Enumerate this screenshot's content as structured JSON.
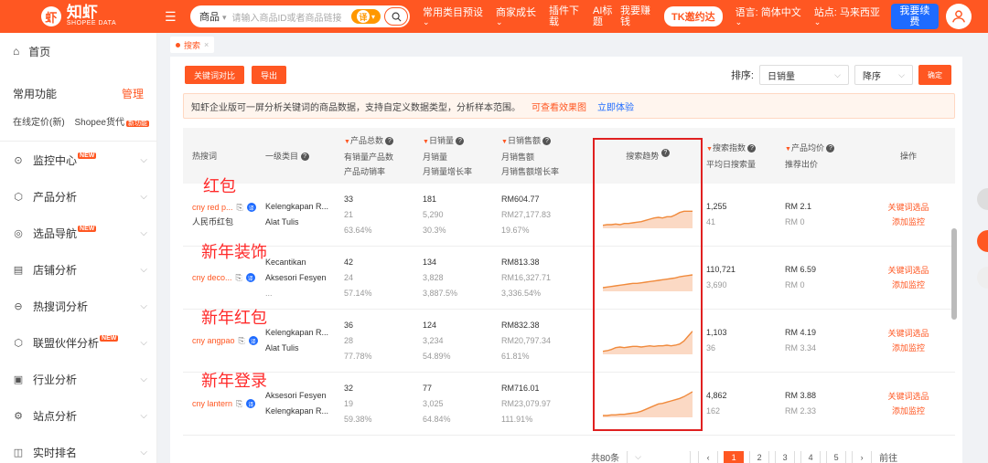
{
  "topbar": {
    "logo_text": "知虾",
    "logo_sub": "SHOPEE DATA",
    "search_select": "商品",
    "search_placeholder": "请输入商品ID或者商品链接",
    "search_badge": "译",
    "nav": [
      {
        "label": "常用类目预设",
        "chev": "⌄"
      },
      {
        "label": "商家成长",
        "chev": "⌄"
      },
      {
        "label": "插件下载",
        "chev": ""
      },
      {
        "label": "AI标题",
        "chev": ""
      },
      {
        "label": "我要赚钱",
        "chev": ""
      }
    ],
    "tk_label": "TK邀约达",
    "language": "语言: 简体中文",
    "site": "站点: 马来西亚",
    "renew_label": "我要续费"
  },
  "sidebar": {
    "home": "首页",
    "common": "常用功能",
    "manage": "管理",
    "quick_left": "在线定价(新)",
    "quick_right": "Shopee货代",
    "quick_tag": "新功能",
    "new_tag": "NEW",
    "items": [
      {
        "label": "监控中心",
        "icon": "⊙",
        "new": true
      },
      {
        "label": "产品分析",
        "icon": "⬡",
        "new": false
      },
      {
        "label": "选品导航",
        "icon": "◎",
        "new": true
      },
      {
        "label": "店铺分析",
        "icon": "▤",
        "new": false
      },
      {
        "label": "热搜词分析",
        "icon": "⊖",
        "new": false
      },
      {
        "label": "联盟伙伴分析",
        "icon": "⬡",
        "new": true
      },
      {
        "label": "行业分析",
        "icon": "▣",
        "new": false
      },
      {
        "label": "站点分析",
        "icon": "⚙",
        "new": false
      },
      {
        "label": "实时排名",
        "icon": "◫",
        "new": false
      }
    ]
  },
  "tab": {
    "label": "搜索",
    "close": "×"
  },
  "toolbar": {
    "compare_label": "关键词对比",
    "export_label": "导出",
    "sort_label": "排序:",
    "sort_field": "日销量",
    "sort_order": "降序",
    "ok_label": "确定"
  },
  "notice": {
    "text": "知虾企业版可一屏分析关键词的商品数据，支持自定义数据类型，分析样本范围。",
    "link1": "可查看效果图",
    "link2": "立即体验"
  },
  "headers": {
    "kw": "热搜词",
    "cat": "一级类目",
    "a": [
      "产品总数",
      "有销量产品数",
      "产品动销率"
    ],
    "b": [
      "日销量",
      "月销量",
      "月销量增长率"
    ],
    "c": [
      "日销售额",
      "月销售额",
      "月销售额增长率"
    ],
    "trend": "搜索趋势",
    "si": [
      "搜索指数",
      "平均日搜索量"
    ],
    "price": [
      "产品均价",
      "推荐出价"
    ],
    "op": "操作"
  },
  "rows": [
    {
      "annot": "红包",
      "kw": "cny red p...",
      "kw_sub": "人民币红包",
      "cat1": "Kelengkapan R...",
      "cat2": "Alat Tulis",
      "a": [
        "33",
        "21",
        "63.64%"
      ],
      "b": [
        "181",
        "5,290",
        "30.3%"
      ],
      "c": [
        "RM604.77",
        "RM27,177.83",
        "19.67%"
      ],
      "trend": [
        5,
        6,
        6,
        7,
        6,
        8,
        8,
        9,
        10,
        11,
        13,
        15,
        17,
        18,
        17,
        19,
        19,
        22,
        26,
        28,
        28,
        28
      ],
      "si": [
        "1,255",
        "41"
      ],
      "price": [
        "RM 2.1",
        "RM 0"
      ],
      "op": [
        "关键词选品",
        "添加监控"
      ]
    },
    {
      "annot": "新年装饰",
      "kw": "cny deco...",
      "kw_sub": "",
      "cat1": "Kecantikan",
      "cat2": "Aksesori Fesyen",
      "cat3": "...",
      "a": [
        "42",
        "24",
        "57.14%"
      ],
      "b": [
        "134",
        "3,828",
        "3,887.5%"
      ],
      "c": [
        "RM813.38",
        "RM16,327.71",
        "3,336.54%"
      ],
      "trend": [
        6,
        7,
        8,
        9,
        10,
        11,
        12,
        13,
        13,
        14,
        15,
        16,
        17,
        18,
        19,
        20,
        21,
        22,
        24,
        25,
        26,
        27
      ],
      "si": [
        "110,721",
        "3,690"
      ],
      "price": [
        "RM 6.59",
        "RM 0"
      ],
      "op": [
        "关键词选品",
        "添加监控"
      ]
    },
    {
      "annot": "新年红包",
      "kw": "cny angpao",
      "kw_sub": "",
      "cat1": "Kelengkapan R...",
      "cat2": "Alat Tulis",
      "a": [
        "36",
        "28",
        "77.78%"
      ],
      "b": [
        "124",
        "3,234",
        "54.89%"
      ],
      "c": [
        "RM832.38",
        "RM20,797.34",
        "61.81%"
      ],
      "trend": [
        5,
        6,
        8,
        11,
        12,
        11,
        12,
        13,
        13,
        12,
        13,
        14,
        13,
        14,
        14,
        15,
        14,
        15,
        17,
        22,
        30,
        38
      ],
      "si": [
        "1,103",
        "36"
      ],
      "price": [
        "RM 4.19",
        "RM 3.34"
      ],
      "op": [
        "关键词选品",
        "添加监控"
      ]
    },
    {
      "annot": "新年登录",
      "kw": "cny lantern",
      "kw_sub": "",
      "cat1": "Aksesori Fesyen",
      "cat2": "Kelengkapan R...",
      "a": [
        "32",
        "19",
        "59.38%"
      ],
      "b": [
        "77",
        "3,025",
        "64.84%"
      ],
      "c": [
        "RM716.01",
        "RM23,079.97",
        "111.91%"
      ],
      "trend": [
        3,
        3,
        4,
        4,
        5,
        5,
        6,
        7,
        8,
        10,
        13,
        16,
        19,
        22,
        23,
        25,
        27,
        29,
        31,
        34,
        38,
        42
      ],
      "si": [
        "4,862",
        "162"
      ],
      "price": [
        "RM 3.88",
        "RM 2.33"
      ],
      "op": [
        "关键词选品",
        "添加监控"
      ]
    }
  ],
  "pager": {
    "label": "共80条",
    "pages": [
      "‹",
      "1",
      "2",
      "3",
      "4",
      "5",
      "›"
    ],
    "jump": "前往"
  },
  "colors": {
    "brand": "#ff5722",
    "link": "#1e6bff",
    "annotation": "#ff2a2a",
    "trend_fill": "#fbd9c4",
    "trend_line": "#f08a3c"
  }
}
